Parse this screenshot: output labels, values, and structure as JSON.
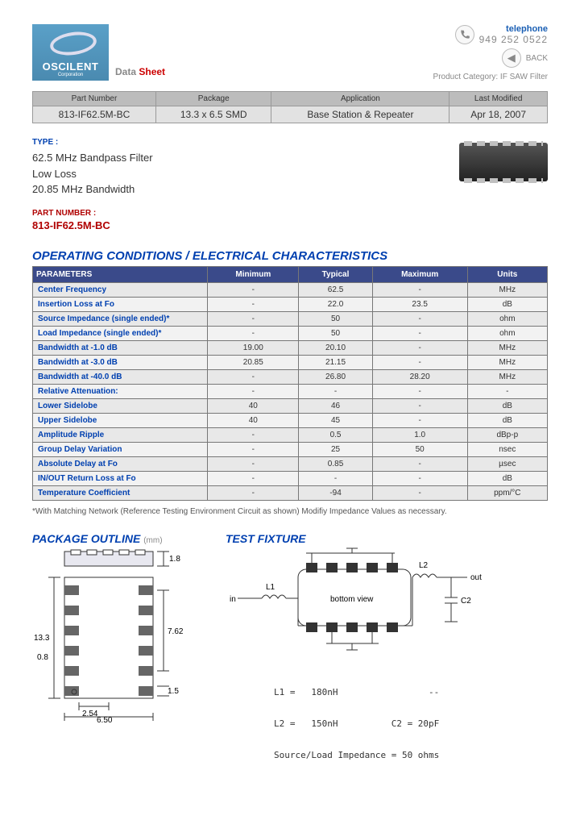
{
  "brand": {
    "name": "OSCILENT",
    "sub": "Corporation"
  },
  "doc_title": {
    "data": "Data",
    "sheet": "Sheet"
  },
  "contact": {
    "tel_label": "telephone",
    "tel_num": "949 252 0522",
    "back": "BACK",
    "prodcat": "Product Category: IF SAW Filter"
  },
  "summary": {
    "headers": [
      "Part Number",
      "Package",
      "Application",
      "Last Modified"
    ],
    "row": [
      "813-IF62.5M-BC",
      "13.3 x 6.5 SMD",
      "Base Station & Repeater",
      "Apr 18, 2007"
    ]
  },
  "type": {
    "label": "TYPE :",
    "lines": [
      "62.5 MHz Bandpass Filter",
      "Low Loss",
      "20.85 MHz Bandwidth"
    ],
    "pn_label": "PART NUMBER :",
    "pn_value": "813-IF62.5M-BC"
  },
  "char_title": "OPERATING CONDITIONS / ELECTRICAL CHARACTERISTICS",
  "char_headers": [
    "PARAMETERS",
    "Minimum",
    "Typical",
    "Maximum",
    "Units"
  ],
  "char_rows": [
    [
      "Center Frequency",
      "-",
      "62.5",
      "-",
      "MHz"
    ],
    [
      "Insertion Loss at Fo",
      "-",
      "22.0",
      "23.5",
      "dB"
    ],
    [
      "Source Impedance (single ended)*",
      "-",
      "50",
      "-",
      "ohm"
    ],
    [
      "Load Impedance (single ended)*",
      "-",
      "50",
      "-",
      "ohm"
    ],
    [
      "Bandwidth at -1.0 dB",
      "19.00",
      "20.10",
      "-",
      "MHz"
    ],
    [
      "Bandwidth at -3.0 dB",
      "20.85",
      "21.15",
      "-",
      "MHz"
    ],
    [
      "Bandwidth at -40.0 dB",
      "-",
      "26.80",
      "28.20",
      "MHz"
    ],
    [
      "Relative Attenuation:",
      "-",
      "-",
      "-",
      "-"
    ],
    [
      "Lower Sidelobe",
      "40",
      "46",
      "-",
      "dB"
    ],
    [
      "Upper Sidelobe",
      "40",
      "45",
      "-",
      "dB"
    ],
    [
      "Amplitude Ripple",
      "-",
      "0.5",
      "1.0",
      "dBp-p"
    ],
    [
      "Group Delay Variation",
      "-",
      "25",
      "50",
      "nsec"
    ],
    [
      "Absolute Delay at Fo",
      "-",
      "0.85",
      "-",
      "µsec"
    ],
    [
      "IN/OUT Return Loss at Fo",
      "-",
      "-",
      "-",
      "dB"
    ],
    [
      "Temperature Coefficient",
      "-",
      "-94",
      "-",
      "ppm/°C"
    ]
  ],
  "char_note": "*With Matching Network (Reference Testing Environment Circuit as shown) Modifiy Impedance Values as necessary.",
  "pkg": {
    "title": "PACKAGE OUTLINE",
    "unit": "(mm)",
    "dims": {
      "top_h": "1.8",
      "length": "13.3",
      "pad_w": "0.8",
      "pitch": "7.62",
      "pad_h": "1.5",
      "col_pitch": "2.54",
      "width": "6.50"
    }
  },
  "fixture": {
    "title": "TEST FIXTURE",
    "labels": {
      "in": "in",
      "out": "out",
      "L1": "L1",
      "L2": "L2",
      "C2": "C2",
      "bottom": "bottom view"
    },
    "vals": [
      "L1 =   180nH                 --",
      "L2 =   150nH          C2 = 20pF",
      "Source/Load Impedance = 50 ohms"
    ]
  }
}
